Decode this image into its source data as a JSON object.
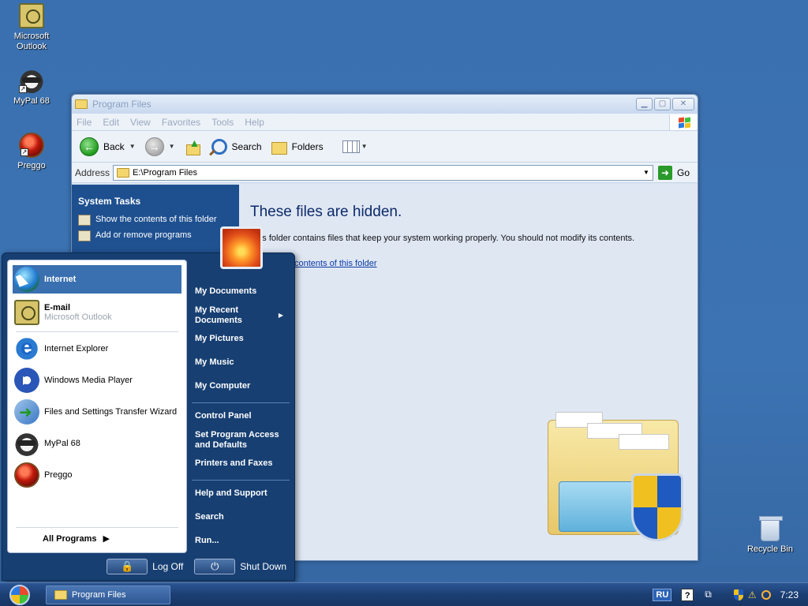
{
  "desktop": {
    "icons": [
      {
        "label": "Microsoft Outlook",
        "icon": "outlook-icon"
      },
      {
        "label": "MyPal 68",
        "icon": "raccoon-icon"
      },
      {
        "label": "Preggo",
        "icon": "preggo-icon"
      }
    ],
    "recycle_bin": "Recycle Bin"
  },
  "window": {
    "title": "Program Files",
    "menu": [
      "File",
      "Edit",
      "View",
      "Favorites",
      "Tools",
      "Help"
    ],
    "toolbar": {
      "back": "Back",
      "search": "Search",
      "folders": "Folders"
    },
    "address": {
      "label": "Address",
      "value": "E:\\Program Files",
      "go": "Go"
    },
    "taskpane": {
      "heading": "System Tasks",
      "tasks": [
        "Show the contents of this folder",
        "Add or remove programs"
      ]
    },
    "main": {
      "title": "These files are hidden.",
      "message": "This folder contains files that keep your system working properly. You should not modify its contents.",
      "message_visible": "folder contains files that keep your system working properly. You should not modify its contents.",
      "link": "contents of this folder"
    }
  },
  "startmenu": {
    "pinned": [
      {
        "title": "Internet",
        "icon": "globe-icon"
      },
      {
        "title": "E-mail",
        "subtitle": "Microsoft Outlook",
        "icon": "outlook-icon"
      }
    ],
    "recent": [
      {
        "label": "Internet Explorer",
        "icon": "ie-icon"
      },
      {
        "label": "Windows Media Player",
        "icon": "wmp-icon"
      },
      {
        "label": "Files and Settings Transfer Wizard",
        "icon": "wizard-icon"
      },
      {
        "label": "MyPal 68",
        "icon": "raccoon-icon"
      },
      {
        "label": "Preggo",
        "icon": "preggo-icon"
      }
    ],
    "all_programs": "All Programs",
    "right": {
      "group1": [
        "My Documents",
        "My Recent Documents",
        "My Pictures",
        "My Music",
        "My Computer"
      ],
      "group2": [
        "Control Panel",
        "Set Program Access and Defaults",
        "Printers and Faxes"
      ],
      "group3": [
        "Help and Support",
        "Search",
        "Run..."
      ]
    },
    "logoff": "Log Off",
    "shutdown": "Shut Down"
  },
  "taskbar": {
    "task": "Program Files",
    "lang": "RU",
    "help": "?",
    "time": "7:23"
  },
  "colors": {
    "desktop": "#3a70b0",
    "taskpane": "#1d4f8f",
    "startmenu": "#173f72",
    "highlight": "#3a6fb0"
  }
}
